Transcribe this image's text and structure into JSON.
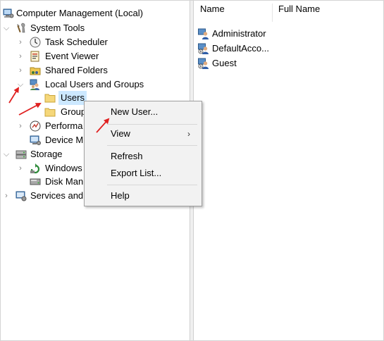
{
  "tree": {
    "root": {
      "label": "Computer Management (Local)"
    },
    "system_tools": {
      "label": "System Tools"
    },
    "task_scheduler": {
      "label": "Task Scheduler"
    },
    "event_viewer": {
      "label": "Event Viewer"
    },
    "shared_folders": {
      "label": "Shared Folders"
    },
    "local_users_groups": {
      "label": "Local Users and Groups"
    },
    "users": {
      "label": "Users"
    },
    "groups": {
      "label": "Group"
    },
    "performance": {
      "label": "Performa"
    },
    "device_manager": {
      "label": "Device M"
    },
    "storage": {
      "label": "Storage"
    },
    "windows_server_backup": {
      "label": "Windows"
    },
    "disk_management": {
      "label": "Disk Man"
    },
    "services_and_apps": {
      "label": "Services and"
    }
  },
  "list": {
    "columns": [
      "Name",
      "Full Name"
    ],
    "rows": [
      {
        "name": "Administrator"
      },
      {
        "name": "DefaultAcco..."
      },
      {
        "name": "Guest"
      }
    ]
  },
  "context_menu": {
    "new_user": "New User...",
    "view": "View",
    "refresh": "Refresh",
    "export_list": "Export List...",
    "help": "Help"
  },
  "colors": {
    "selection": "#cce8ff",
    "annotation_arrow": "#e02020",
    "folder": "#f5d77a"
  },
  "icons": {
    "computer": "computer-management-icon",
    "tools": "system-tools-icon",
    "clock": "task-scheduler-icon",
    "log": "event-viewer-icon",
    "share": "shared-folders-icon",
    "users": "local-users-groups-icon",
    "folder": "folder-icon",
    "perf": "performance-icon",
    "device": "device-manager-icon",
    "storage": "storage-icon",
    "backup": "windows-backup-icon",
    "disk": "disk-management-icon",
    "user": "user-account-icon"
  }
}
